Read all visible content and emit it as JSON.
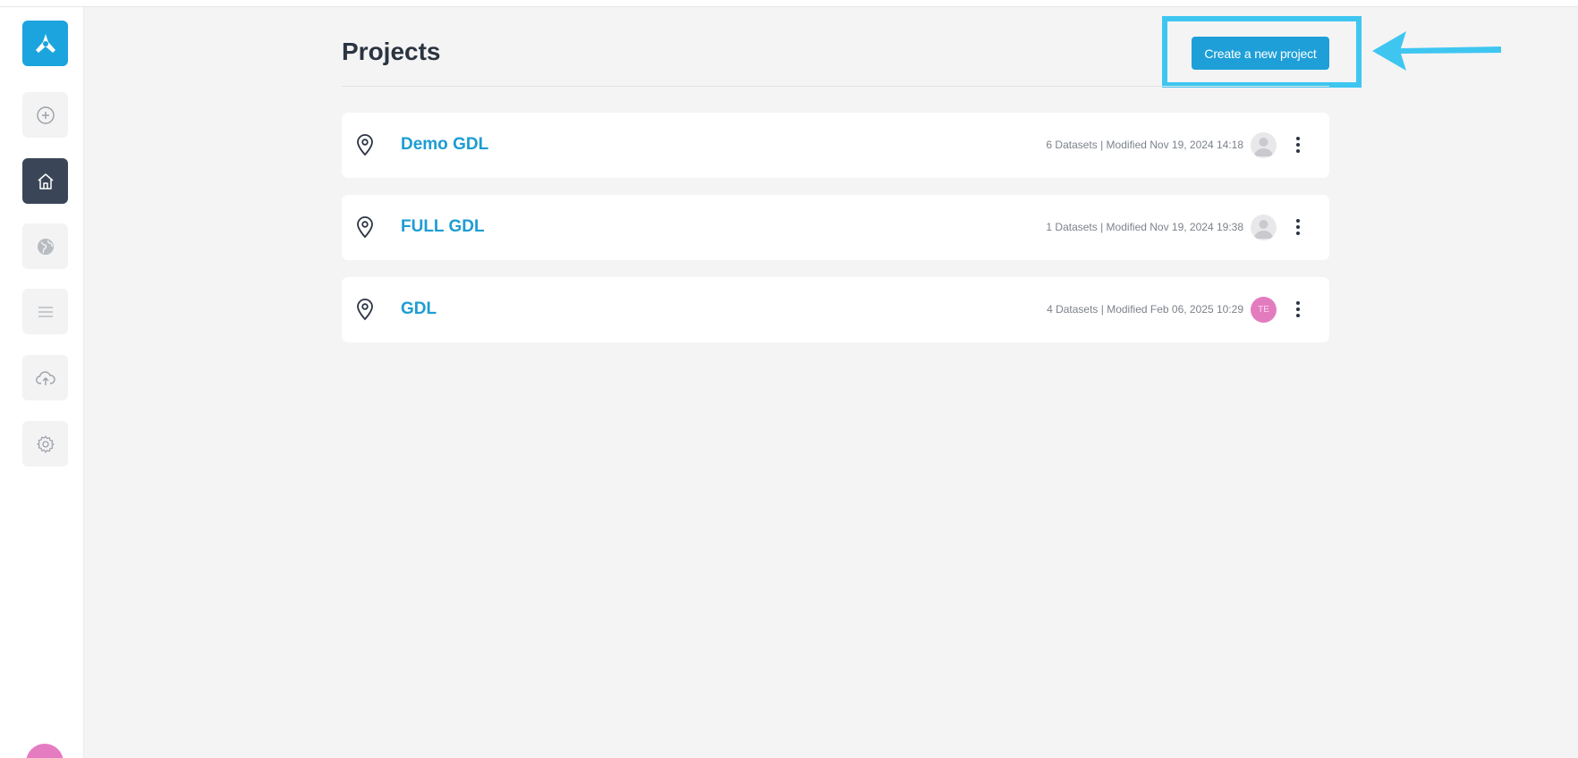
{
  "page": {
    "title": "Projects"
  },
  "toolbar": {
    "create_label": "Create a new project"
  },
  "sidebar": {
    "items": [
      {
        "name": "logo",
        "icon": "logo-icon"
      },
      {
        "name": "add",
        "icon": "plus-circle-icon"
      },
      {
        "name": "home",
        "icon": "home-icon",
        "active": true
      },
      {
        "name": "globe",
        "icon": "globe-icon"
      },
      {
        "name": "list",
        "icon": "menu-icon"
      },
      {
        "name": "upload",
        "icon": "cloud-upload-icon"
      },
      {
        "name": "settings",
        "icon": "gear-icon"
      }
    ]
  },
  "projects": [
    {
      "name": "Demo GDL",
      "meta": "6 Datasets | Modified Nov 19, 2024 14:18",
      "avatar": "default"
    },
    {
      "name": "FULL GDL",
      "meta": "1 Datasets | Modified Nov 19, 2024 19:38",
      "avatar": "default"
    },
    {
      "name": "GDL",
      "meta": "4 Datasets | Modified Feb 06, 2025 10:29",
      "avatar": "initials",
      "initials": "TE"
    }
  ],
  "colors": {
    "accent": "#1e9fd8",
    "highlight": "#3ec6f1",
    "sidebar_active": "#3a4657",
    "avatar_pink": "#e37cbf"
  }
}
